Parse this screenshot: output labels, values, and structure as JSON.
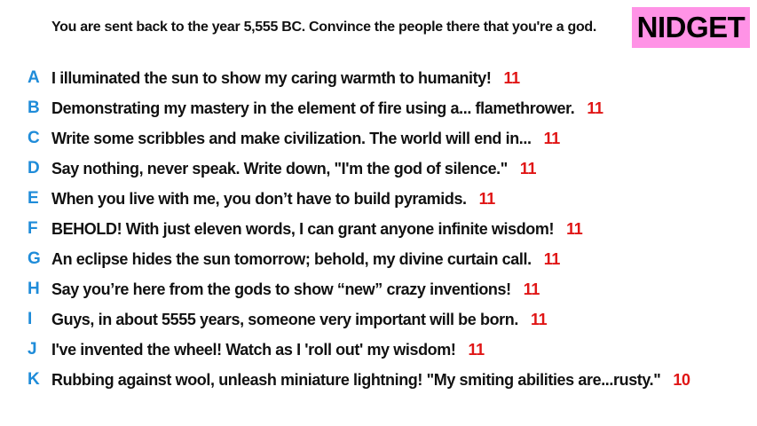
{
  "prompt": "You are sent back to the year 5,555 BC. Convince the people there that you're a god.",
  "brand": "NIDGET",
  "colors": {
    "letter": "#1f8cd9",
    "score": "#e01515",
    "brand_bg": "#ff93e6"
  },
  "answers": [
    {
      "letter": "A",
      "text": "I illuminated the sun to show my caring warmth to humanity!",
      "score": "11"
    },
    {
      "letter": "B",
      "text": "Demonstrating my mastery in the element of fire using a... flamethrower.",
      "score": "11"
    },
    {
      "letter": "C",
      "text": "Write some scribbles and make civilization. The world will end in...",
      "score": "11"
    },
    {
      "letter": "D",
      "text": "Say nothing, never speak. Write down, \"I'm the god of silence.\"",
      "score": "11"
    },
    {
      "letter": "E",
      "text": "When you live with me, you don’t have to build pyramids.",
      "score": "11"
    },
    {
      "letter": "F",
      "text": "BEHOLD! With just eleven words, I can grant anyone infinite wisdom!",
      "score": "11"
    },
    {
      "letter": "G",
      "text": "An eclipse hides the sun tomorrow; behold, my divine curtain call.",
      "score": "11"
    },
    {
      "letter": "H",
      "text": "Say you’re here from the gods to show “new” crazy inventions!",
      "score": "11"
    },
    {
      "letter": "I",
      "text": "Guys, in about 5555 years, someone very important will be born.",
      "score": "11"
    },
    {
      "letter": "J",
      "text": "I've invented the wheel! Watch as I 'roll out' my wisdom!",
      "score": "11"
    },
    {
      "letter": "K",
      "text": "Rubbing against wool, unleash miniature lightning! \"My smiting abilities are...rusty.\"",
      "score": "10"
    }
  ]
}
